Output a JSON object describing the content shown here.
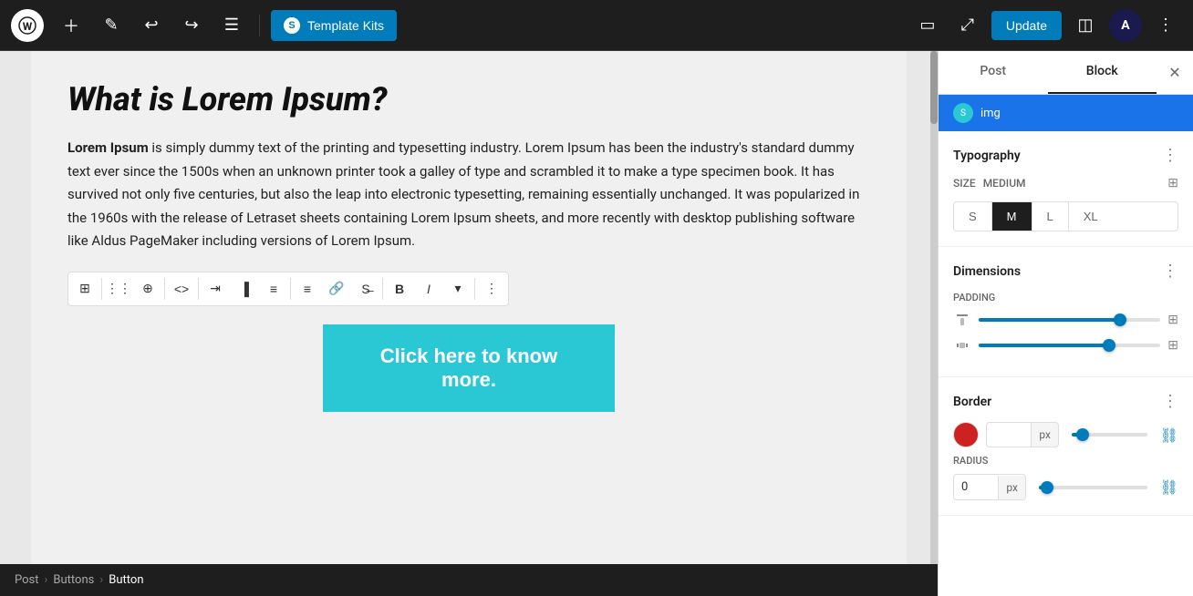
{
  "toolbar": {
    "template_kits_label": "Template Kits",
    "update_label": "Update",
    "astra_label": "A"
  },
  "panel": {
    "tab_post": "Post",
    "tab_block": "Block",
    "typography_title": "Typography",
    "size_label": "SIZE",
    "size_value": "MEDIUM",
    "size_options": [
      "S",
      "M",
      "L",
      "XL"
    ],
    "size_active": "M",
    "dimensions_title": "Dimensions",
    "padding_label": "PADDING",
    "border_title": "Border",
    "border_px": "px",
    "radius_label": "RADIUS",
    "radius_value": "0",
    "radius_px": "px"
  },
  "editor": {
    "heading": "What is Lorem Ipsum?",
    "paragraph_start": "Lorem Ipsum",
    "paragraph_rest": " is simply dummy text of the printing and typesetting industry. Lorem Ipsum has been the industry's standard dummy text ever since the 1500s when an unknown printer took a galley of type and scrambled it to make a type specimen book. It has survived not only five centuries, but also the leap into electronic typesetting, remaining essentially unchanged. It was popularized in the 1960s with the release of Letraset sheets containing Lorem Ipsum sheets, and more recently with desktop publishing software like Aldus PageMaker including versions of Lorem Ipsum.",
    "cta_label": "Click here to know more."
  },
  "breadcrumb": {
    "items": [
      "Post",
      "Buttons",
      "Button"
    ]
  },
  "slider1_fill_pct": 78,
  "slider2_fill_pct": 72,
  "slider3_fill_pct": 15
}
